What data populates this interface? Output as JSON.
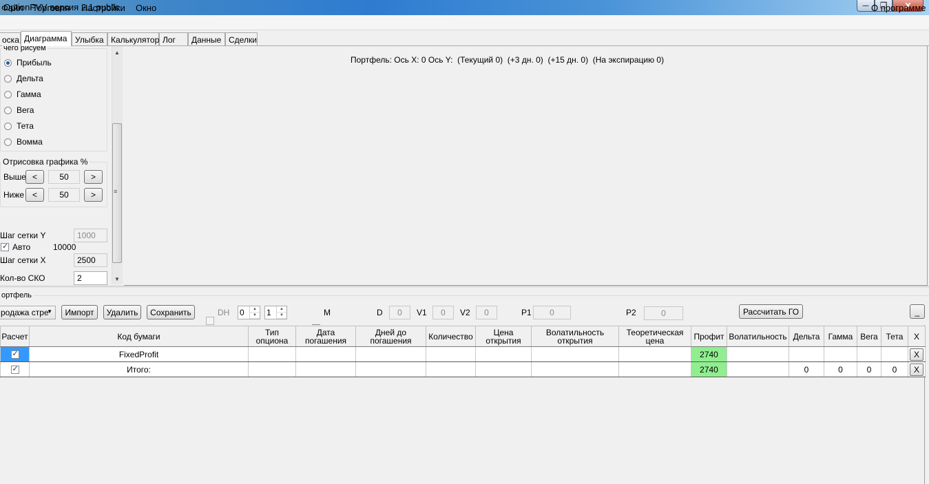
{
  "window": {
    "title": "OptionFVV версия 2.1 public",
    "min": "─",
    "max": "❐",
    "close": "✕"
  },
  "menu": {
    "file": "Файл",
    "trade": "Торговля",
    "settings": "Настройки",
    "window": "Окно",
    "about": "О программе"
  },
  "tabs": [
    "оска",
    "Диаграмма",
    "Улыбка",
    "Калькулятор",
    "Лог",
    "Данные",
    "Сделки"
  ],
  "left": {
    "draw_group": "чего рисуем",
    "radios": [
      {
        "label": "Прибыль",
        "checked": true
      },
      {
        "label": "Дельта",
        "checked": false
      },
      {
        "label": "Гамма",
        "checked": false
      },
      {
        "label": "Вега",
        "checked": false
      },
      {
        "label": "Тета",
        "checked": false
      },
      {
        "label": "Вомма",
        "checked": false
      }
    ],
    "range_group": "Отрисовка графика %",
    "above_label": "Выше",
    "above_value": "50",
    "below_label": "Ниже",
    "below_value": "50",
    "dec": "<",
    "inc": ">",
    "grid_y_label": "Шаг сетки Y",
    "grid_y_value": "1000",
    "auto_label": "Авто",
    "auto_value": "10000",
    "auto_checked": true,
    "grid_x_label": "Шаг сетки X",
    "grid_x_value": "2500",
    "sko_label": "Кол-во СКО",
    "sko_value": "2"
  },
  "chart": {
    "caption": "Портфель: Ось X: 0 Ось Y:  (Текущий 0)  (+3 дн. 0)  (+15 дн. 0)  (На экспирацию 0)"
  },
  "portfolio": {
    "title": "ортфель",
    "strategy": "родажа стре",
    "import": "Импорт",
    "delete": "Удалить",
    "save": "Сохранить",
    "dh_label": "DH",
    "spin1": "0",
    "spin2": "1",
    "m_label": "M",
    "d_label": "D",
    "d_value": "0",
    "v1_label": "V1",
    "v1_value": "0",
    "v2_label": "V2",
    "v2_value": "0",
    "p1_label": "P1",
    "p1_value": "0",
    "p2_label": "P2",
    "p2_value": "0",
    "calc_go": "Рассчитать ГО",
    "minimize": "_"
  },
  "table": {
    "headers": [
      "Расчет",
      "Код бумаги",
      "Тип\nопциона",
      "Дата\nпогашения",
      "Дней до\nпогашения",
      "Количество",
      "Цена\nоткрытия",
      "Волатильность\nоткрытия",
      "Теоретическая\nцена",
      "Профит",
      "Волатильность",
      "Дельта",
      "Гамма",
      "Вега",
      "Тета",
      "X"
    ],
    "rows": [
      {
        "code": "FixedProfit",
        "profit": "2740",
        "delta": "",
        "gamma": "",
        "vega": "",
        "theta": "",
        "x": "X"
      },
      {
        "code": "Итого:",
        "profit": "2740",
        "delta": "0",
        "gamma": "0",
        "vega": "0",
        "theta": "0",
        "x": "X"
      }
    ]
  }
}
